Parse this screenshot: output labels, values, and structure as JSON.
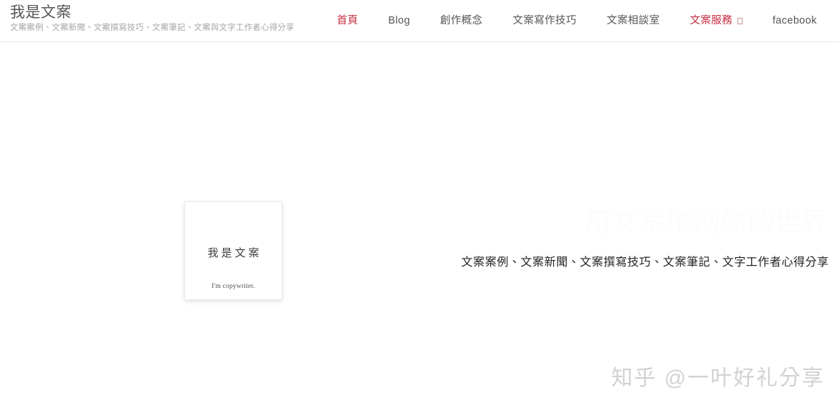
{
  "page": {
    "background_color": "#ffffff",
    "accent_color": "#c62a3c",
    "text_color": "#555555"
  },
  "header": {
    "brand_title": "我是文案",
    "brand_tagline": "文案案例、文案新聞、文案撰寫技巧、文案筆記、文案與文字工作者心得分享",
    "nav": [
      {
        "label": "首頁",
        "active": true,
        "has_dropdown": false
      },
      {
        "label": "Blog",
        "active": false,
        "has_dropdown": false
      },
      {
        "label": "創作概念",
        "active": false,
        "has_dropdown": false
      },
      {
        "label": "文案寫作技巧",
        "active": false,
        "has_dropdown": false
      },
      {
        "label": "文案相談室",
        "active": false,
        "has_dropdown": false
      },
      {
        "label": "文案服務",
        "active": true,
        "has_dropdown": true
      },
      {
        "label": "facebook",
        "active": false,
        "has_dropdown": false
      }
    ]
  },
  "hero": {
    "card": {
      "title": "我是文案",
      "subtitle": "I'm copywriter."
    },
    "ghost_title": "用文案堆砌你的世界",
    "subtitle": "文案案例、文案新聞、文案撰寫技巧、文案筆記、文字工作者心得分享"
  },
  "watermark": {
    "text": "知乎 @一叶好礼分享"
  }
}
